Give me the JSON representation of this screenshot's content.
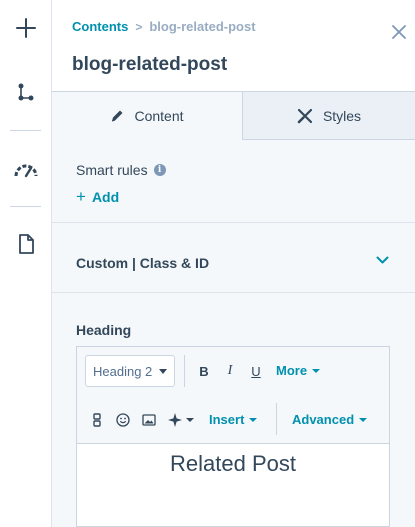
{
  "breadcrumb": {
    "parent": "Contents",
    "separator": ">",
    "current": "blog-related-post"
  },
  "panel_title": "blog-related-post",
  "tabs": [
    {
      "label": "Content",
      "icon": "pencil-icon",
      "active": true
    },
    {
      "label": "Styles",
      "icon": "brush-icon",
      "active": false
    }
  ],
  "smart_rules": {
    "label": "Smart rules",
    "info_glyph": "i",
    "add_plus": "+",
    "add_label": "Add"
  },
  "custom_section": {
    "label": "Custom | Class & ID"
  },
  "heading_field": {
    "label": "Heading",
    "style_select": "Heading 2",
    "toolbar": {
      "bold": "B",
      "italic": "I",
      "underline": "U",
      "more": "More",
      "insert": "Insert",
      "advanced": "Advanced"
    },
    "content": "Related Post"
  },
  "colors": {
    "accent": "#0091ae",
    "text": "#33475b",
    "panel_bg": "#f5f8fa",
    "border": "#cbd6e2"
  }
}
